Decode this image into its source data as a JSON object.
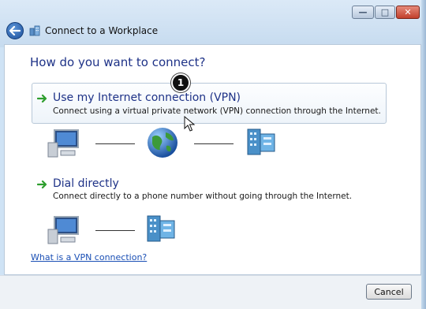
{
  "window": {
    "title": "Connect to a Workplace",
    "controls": {
      "minimize": "—",
      "maximize": "□",
      "close": "✕"
    }
  },
  "heading": "How do you want to connect?",
  "options": [
    {
      "title": "Use my Internet connection (VPN)",
      "description": "Connect using a virtual private network (VPN) connection through the Internet.",
      "diagram": [
        "computer-icon",
        "globe-icon",
        "server-icon"
      ]
    },
    {
      "title": "Dial directly",
      "description": "Connect directly to a phone number without going through the Internet.",
      "diagram": [
        "computer-icon",
        "server-icon"
      ]
    }
  ],
  "annotation_badge": "1",
  "help_link": "What is a VPN connection?",
  "buttons": {
    "cancel": "Cancel"
  },
  "colors": {
    "heading": "#1e3287",
    "link": "#1a4fb5",
    "arrow": "#2e9e2e"
  }
}
